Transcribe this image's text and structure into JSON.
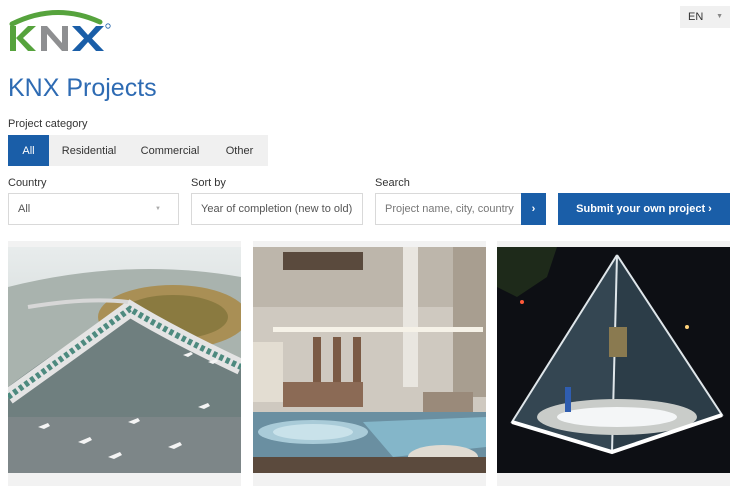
{
  "header": {
    "logo_text": "KNX",
    "language": "EN"
  },
  "page": {
    "title": "KNX Projects"
  },
  "category": {
    "label": "Project category",
    "tabs": [
      {
        "label": "All",
        "active": true
      },
      {
        "label": "Residential",
        "active": false
      },
      {
        "label": "Commercial",
        "active": false
      },
      {
        "label": "Other",
        "active": false
      }
    ]
  },
  "filters": {
    "country": {
      "label": "Country",
      "value": "All"
    },
    "sort": {
      "label": "Sort by",
      "value": "Year of completion (new to old)"
    },
    "search": {
      "label": "Search",
      "placeholder": "Project name, city, country"
    }
  },
  "actions": {
    "search_button": "›",
    "submit_button": "Submit your own project ›"
  },
  "colors": {
    "brand_blue": "#1a5ea8",
    "title_blue": "#2e6bb3",
    "logo_green": "#56a33d",
    "logo_gray": "#8e8f91"
  }
}
